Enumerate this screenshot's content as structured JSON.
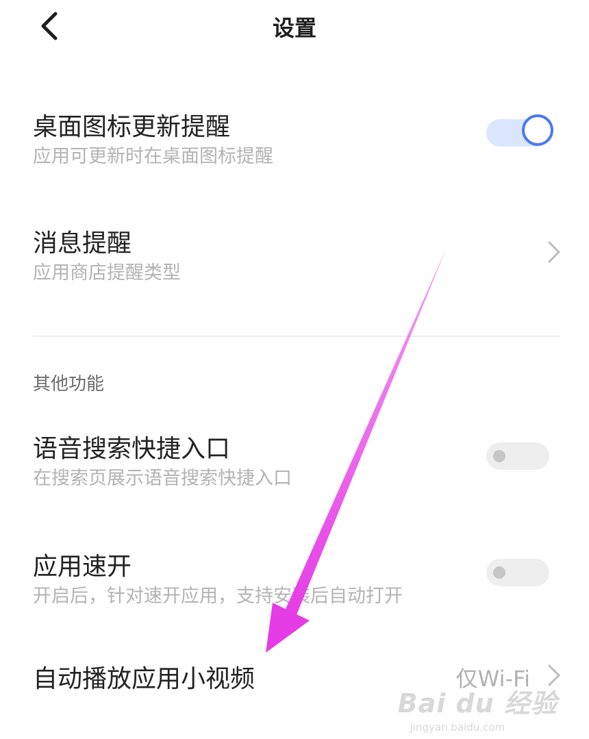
{
  "header": {
    "back_icon": "chevron-left-icon",
    "title": "设置"
  },
  "rows": [
    {
      "title": "桌面图标更新提醒",
      "subtitle": "应用可更新时在桌面图标提醒",
      "control": "toggle",
      "checked": true
    },
    {
      "title": "消息提醒",
      "subtitle": "应用商店提醒类型",
      "control": "chevron",
      "icon": "chevron-right-icon"
    }
  ],
  "other_section": {
    "label": "其他功能",
    "rows": [
      {
        "title": "语音搜索快捷入口",
        "subtitle": "在搜索页展示语音搜索快捷入口",
        "control": "toggle",
        "checked": false
      },
      {
        "title": "应用速开",
        "subtitle": "开启后，针对速开应用，支持安装后自动打开",
        "control": "toggle",
        "checked": false
      },
      {
        "title": "自动播放应用小视频",
        "value": "仅Wi-Fi",
        "control": "chevron",
        "icon": "chevron-right-icon"
      }
    ]
  },
  "annotation": {
    "arrow_color": "#e63ce6"
  },
  "watermark": {
    "logo": "Bai du 经验",
    "url": "jingyan.baidu.com"
  },
  "colors": {
    "accent": "#4a79f2",
    "toggle_on_track": "#dbe6ff",
    "toggle_off_track": "#eeeeee",
    "subtitle": "#b3b3b3"
  }
}
